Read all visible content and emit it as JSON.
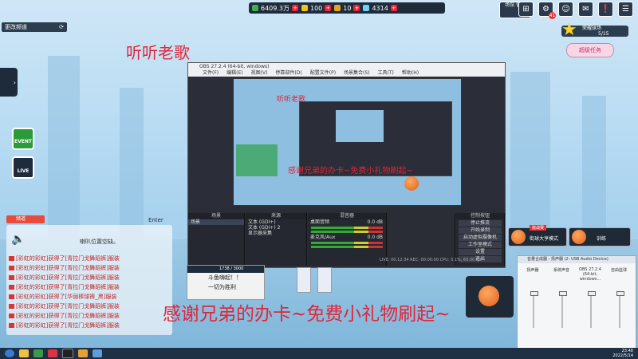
{
  "top_bar": {
    "res1_value": "6409.3万",
    "res2_value": "100",
    "res3_value": "10",
    "res4_value": "4314"
  },
  "top_icons": {
    "guan": "场馆\n管理",
    "mail_badge": "41"
  },
  "left": {
    "channel_label": "更改频道",
    "event_label": "EVENT",
    "live_label": "LIVE"
  },
  "overlay": {
    "title": "听听老歌",
    "thanks": "感谢兄弟的办卡~免费小礼物刷起~"
  },
  "obs": {
    "window_title": "OBS 27.2.4 (64-bit, windows)",
    "menu": [
      "文件(F)",
      "编辑(E)",
      "视图(V)",
      "停靠部件(D)",
      "配置文件(P)",
      "场景集合(S)",
      "工具(T)",
      "帮助(H)"
    ],
    "preview_title": "听听老歌",
    "preview_thanks": "感谢兄弟的办卡~免费小礼物刷起~",
    "docks": {
      "scenes_header": "场景",
      "sources_header": "来源",
      "mixer_header": "混音器",
      "controls_header": "控制按钮",
      "scene_items": [
        "场景"
      ],
      "source_items": [
        "文本 (GDI+)",
        "文本 (GDI+) 2",
        "显示器采集"
      ],
      "mixer_channels": [
        "桌面音频",
        "麦克风/Aux"
      ],
      "mixer_db": [
        "0.0 dB",
        "0.0 dB"
      ],
      "controls": [
        "停止推流",
        "开始录制",
        "启动虚拟摄像机",
        "工作室模式",
        "设置",
        "退出"
      ]
    },
    "status": "LIVE: 00:12:34   REC: 00:00:00   CPU: 3.1%, 60.00 fps"
  },
  "chat": {
    "tab_label": "频道",
    "enter_label": "Enter",
    "system_msg": "喇叭位置空缺。",
    "lines": [
      {
        "prefix": "[彩虹的彩虹]",
        "mid": "获得了",
        "item": "[青拉门戈舞蹈裤]",
        "suffix": "服装"
      },
      {
        "prefix": "[彩虹的彩虹]",
        "mid": "获得了",
        "item": "[青拉门戈舞蹈裤]",
        "suffix": "服装"
      },
      {
        "prefix": "[彩虹的彩虹]",
        "mid": "获得了",
        "item": "[青拉门戈舞蹈裤]",
        "suffix": "服装"
      },
      {
        "prefix": "[彩虹的彩虹]",
        "mid": "获得了",
        "item": "[青拉门戈舞蹈裤]",
        "suffix": "服装"
      },
      {
        "prefix": "[彩虹的彩虹]",
        "mid": "获得了",
        "item": "[华丽棒球裤_黑]",
        "suffix": "服装"
      },
      {
        "prefix": "[彩虹的彩虹]",
        "mid": "获得了",
        "item": "[青拉门戈舞蹈裤]",
        "suffix": "服装"
      },
      {
        "prefix": "[彩虹的彩虹]",
        "mid": "获得了",
        "item": "[青拉门戈舞蹈裤]",
        "suffix": "服装"
      },
      {
        "prefix": "[彩虹的彩虹]",
        "mid": "获得了",
        "item": "[青拉门戈舞蹈裤]",
        "suffix": "服装"
      }
    ]
  },
  "player_panel": {
    "exp": "1738 / 3000",
    "line1": "斗鱼嗨起！！",
    "line2": "一切为胜利"
  },
  "right": {
    "mission_title": "荣耀球场",
    "progress": "5/15",
    "task_label": "超级任务",
    "mode1_tag": "挑战赛",
    "mode1_label": "街球大亨模式",
    "mode2_label": "训练"
  },
  "audio_dialog": {
    "title": "音量合成器 - 扬声器 (2- USB Audio Device)",
    "channels": [
      "扬声器",
      "系统声音",
      "OBS 27.2.4 (64-bit, windows...",
      "自由篮球"
    ]
  },
  "taskbar": {
    "time": "23:48",
    "date": "2022/5/14"
  },
  "colors": {
    "accent_red": "#e0263a",
    "dark_panel": "#1d2b3a",
    "chat_item": "#c02828"
  }
}
